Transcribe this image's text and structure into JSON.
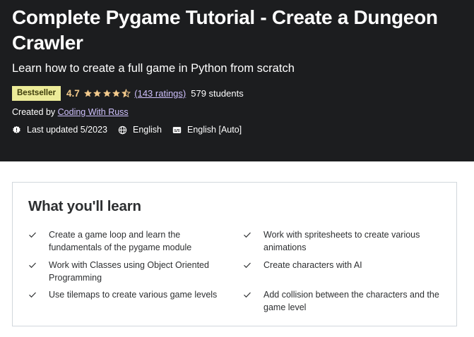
{
  "course": {
    "title": "Complete Pygame Tutorial - Create a Dungeon Crawler",
    "subtitle": "Learn how to create a full game in Python from scratch",
    "badge": "Bestseller",
    "rating": "4.7",
    "rating_stars": 4.7,
    "ratings_count": "(143 ratings)",
    "students": "579 students",
    "created_by_label": "Created by",
    "author": "Coding With Russ",
    "last_updated": "Last updated 5/2023",
    "language": "English",
    "captions": "English [Auto]"
  },
  "colors": {
    "hero_bg": "#1c1d1f",
    "badge_bg": "#eceb98",
    "rating": "#f3ca8c",
    "link": "#cec0fc"
  },
  "icons": {
    "update": "alert-badge-icon",
    "language": "globe-icon",
    "captions": "closed-captions-icon",
    "check": "check-icon",
    "star": "star-icon"
  },
  "learn": {
    "heading": "What you'll learn",
    "items": [
      {
        "line1": "Create a game loop and learn the",
        "line2": "fundamentals of the pygame module"
      },
      {
        "line1": "Work with spritesheets to create various",
        "line2": "animations"
      },
      {
        "line1": "Work with Classes using Object Oriented",
        "line2": "Programming"
      },
      {
        "line1": "Create characters with AI",
        "line2": ""
      },
      {
        "line1": "Use tilemaps to create various game levels",
        "line2": ""
      },
      {
        "line1": "Add collision between the characters and the",
        "line2": "game level"
      }
    ]
  }
}
